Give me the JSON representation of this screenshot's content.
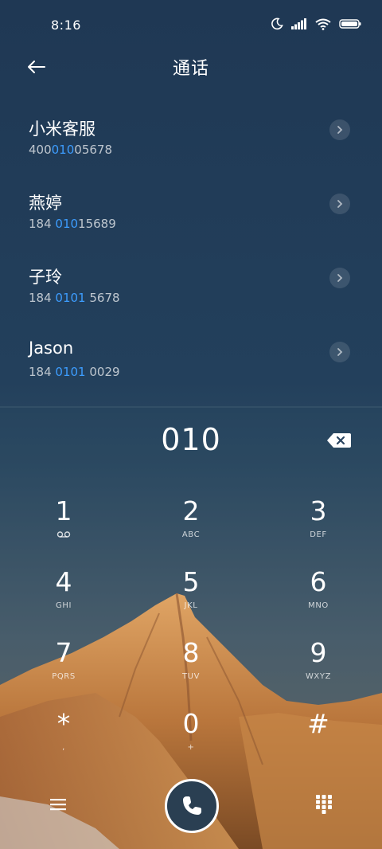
{
  "status_bar": {
    "time": "8:16",
    "icons": [
      "moon-icon",
      "signal-icon",
      "wifi-icon",
      "battery-icon"
    ]
  },
  "header": {
    "title": "通话",
    "back_icon": "back-arrow-icon"
  },
  "contacts": [
    {
      "name": "小米客服",
      "number_pre": "400",
      "number_match": "010",
      "number_post": "05678"
    },
    {
      "name": "燕婷",
      "number_pre": "184 ",
      "number_match": "010",
      "number_post": "15689"
    },
    {
      "name": "子玲",
      "number_pre": "184 ",
      "number_match": "0101",
      "number_post": " 5678"
    },
    {
      "name": "Jason",
      "number_pre": "184 ",
      "number_match": "0101",
      "number_post": " 0029"
    }
  ],
  "dialer": {
    "input": "010",
    "backspace_icon": "backspace-icon"
  },
  "keypad": [
    {
      "digit": "1",
      "sub": ""
    },
    {
      "digit": "2",
      "sub": "ABC"
    },
    {
      "digit": "3",
      "sub": "DEF"
    },
    {
      "digit": "4",
      "sub": "GHI"
    },
    {
      "digit": "5",
      "sub": "JKL"
    },
    {
      "digit": "6",
      "sub": "MNO"
    },
    {
      "digit": "7",
      "sub": "PQRS"
    },
    {
      "digit": "8",
      "sub": "TUV"
    },
    {
      "digit": "9",
      "sub": "WXYZ"
    },
    {
      "digit": "*",
      "sub": ","
    },
    {
      "digit": "0",
      "sub": "+"
    },
    {
      "digit": "#",
      "sub": ""
    }
  ],
  "bottom_bar": {
    "menu_icon": "menu-icon",
    "call_icon": "phone-icon",
    "dialpad_icon": "dialpad-icon"
  },
  "colors": {
    "highlight": "#3d9dff",
    "background_top": "#203a56"
  }
}
